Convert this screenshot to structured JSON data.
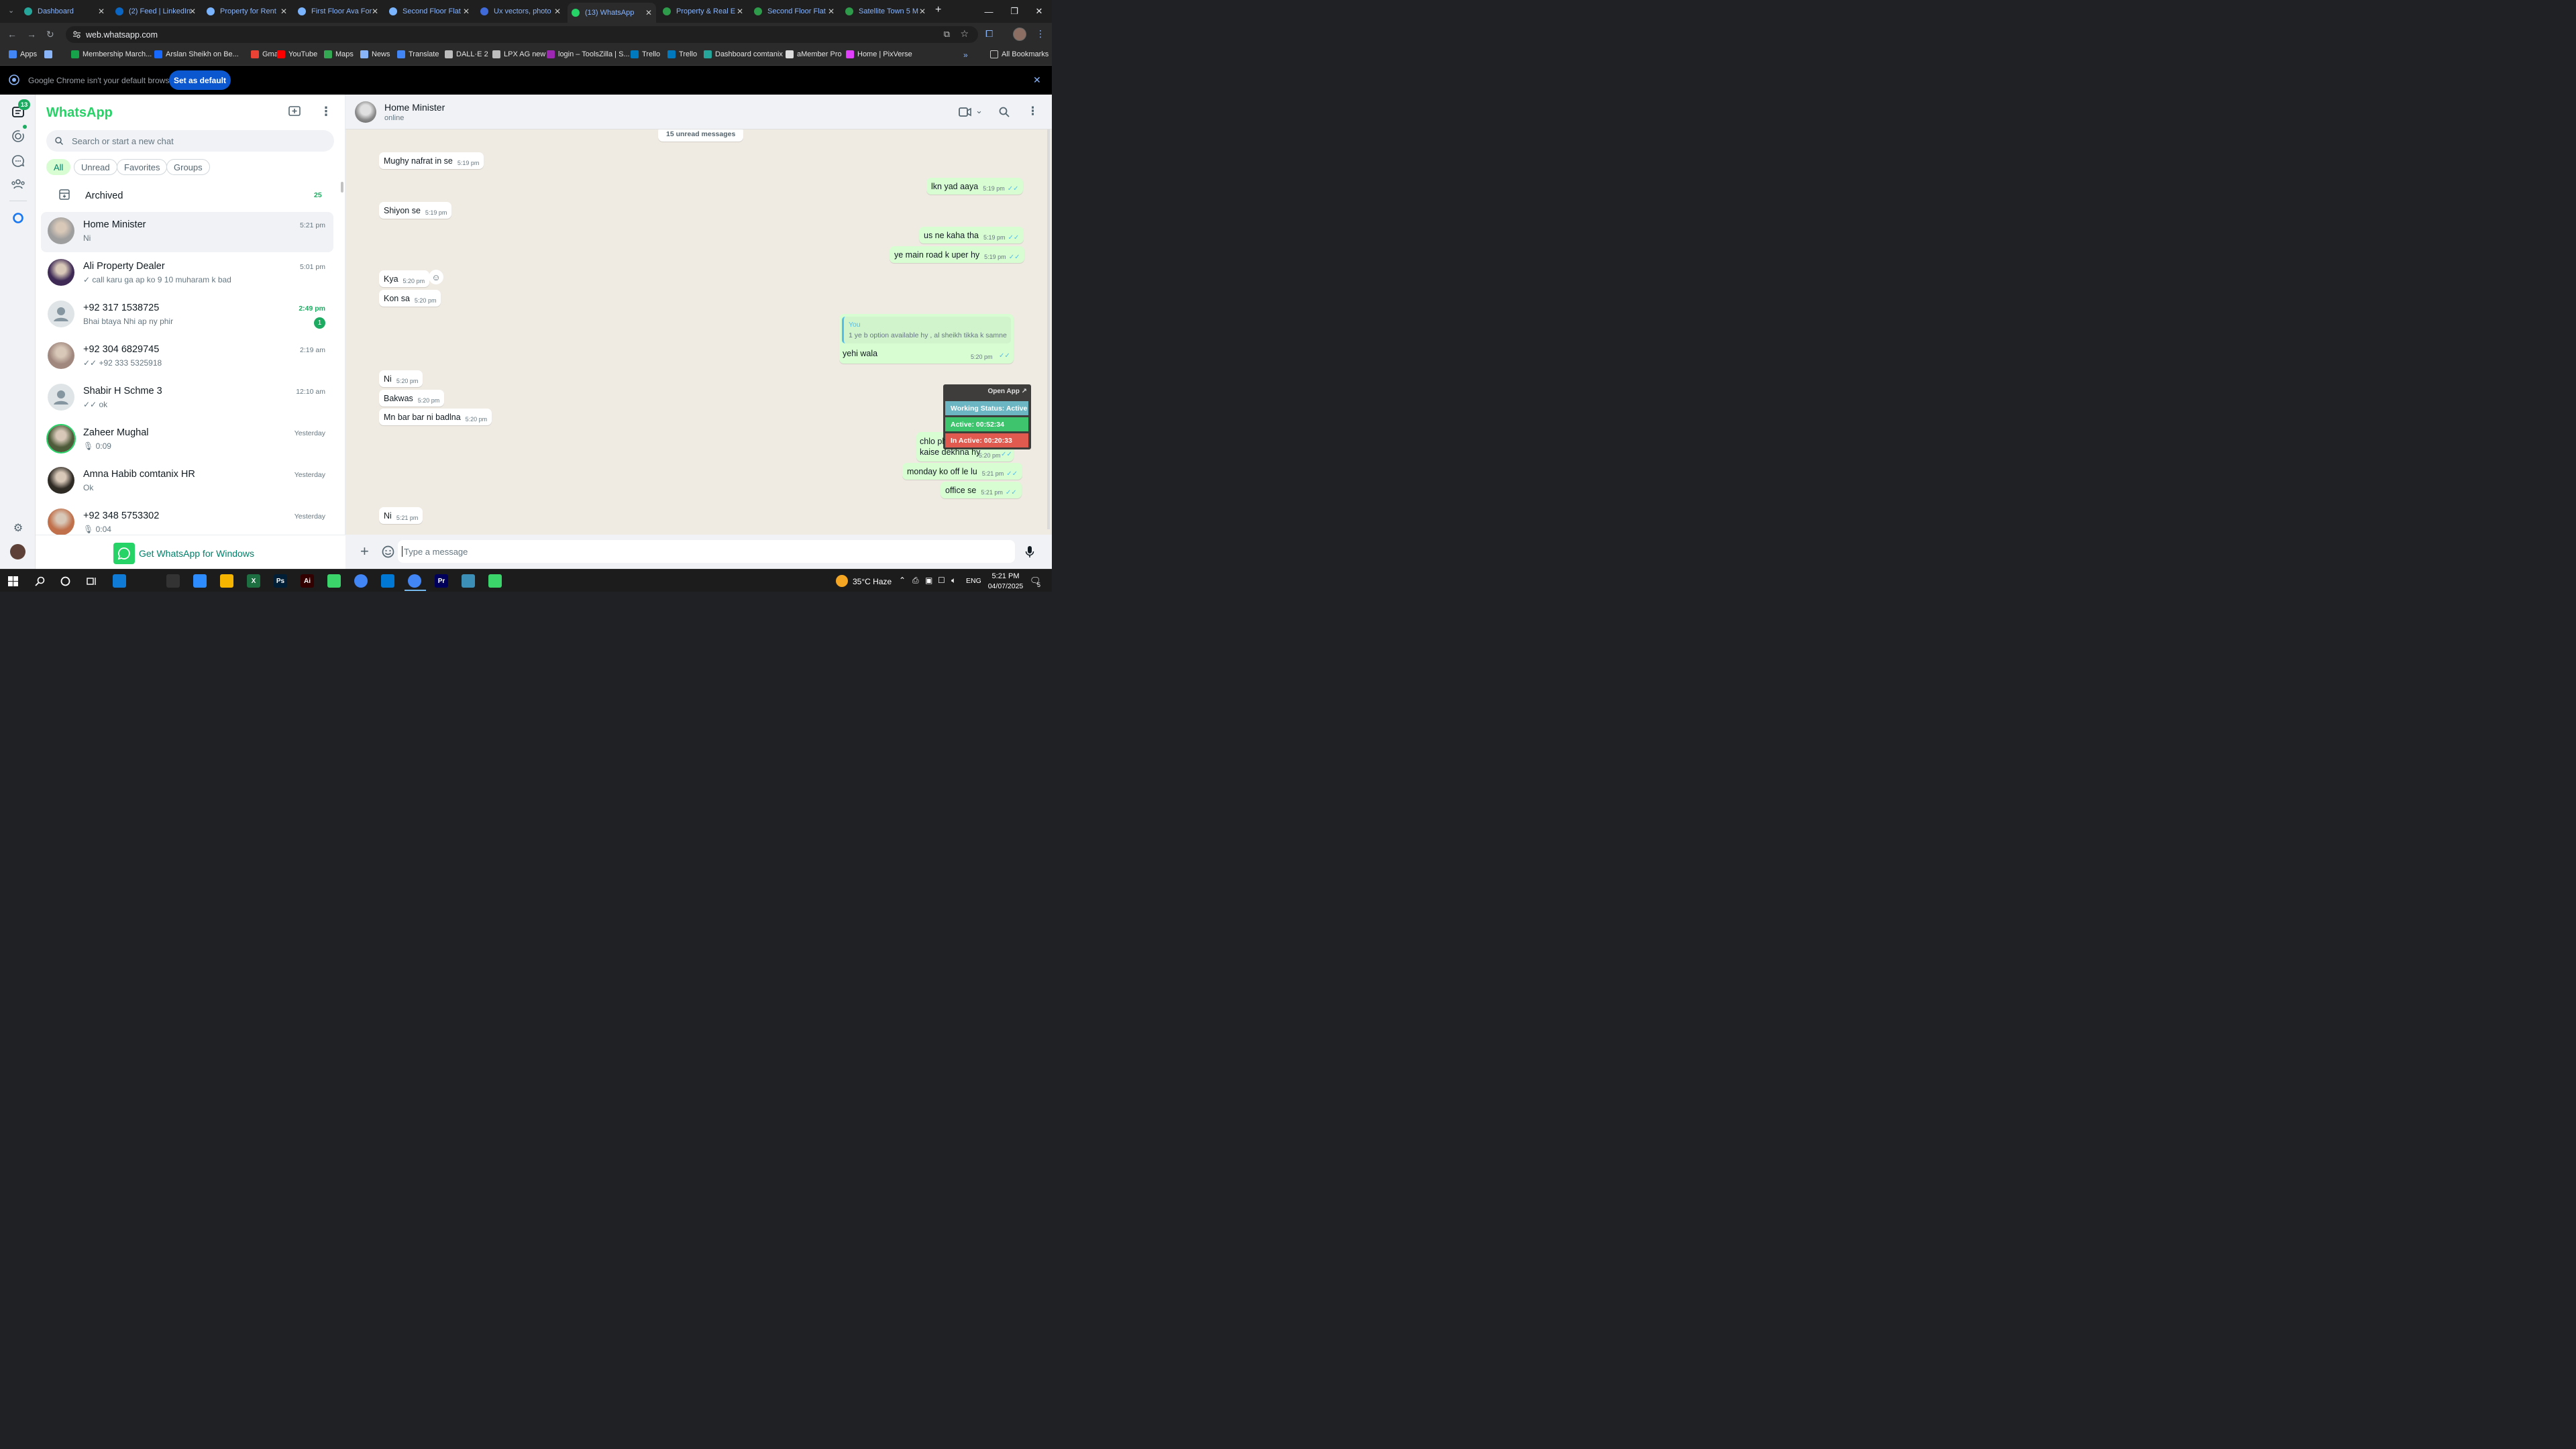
{
  "tabs": [
    {
      "label": "Dashboard",
      "color": "#26a69a"
    },
    {
      "label": "(2) Feed | LinkedIn",
      "color": "#0a66c2"
    },
    {
      "label": "Property for Rent",
      "color": "#7ab4ff"
    },
    {
      "label": "First Floor Ava For",
      "color": "#7ab4ff"
    },
    {
      "label": "Second Floor Flat",
      "color": "#7ab4ff"
    },
    {
      "label": "Ux vectors, photo",
      "color": "#3f6ad8"
    },
    {
      "label": "(13) WhatsApp",
      "color": "#25d366",
      "active": true
    },
    {
      "label": "Property & Real E",
      "color": "#2e9b4b"
    },
    {
      "label": "Second Floor Flat",
      "color": "#2e9b4b"
    },
    {
      "label": "Satellite Town 5 M",
      "color": "#2e9b4b"
    }
  ],
  "address_bar": {
    "url": "web.whatsapp.com"
  },
  "bookmarks": [
    {
      "label": "Apps",
      "color": "#4285f4"
    },
    {
      "label": "",
      "color": "#8ab4f8"
    },
    {
      "label": "Membership March...",
      "color": "#16a34a"
    },
    {
      "label": "Arslan Sheikh on Be...",
      "color": "#1769ff"
    },
    {
      "label": "Gmail",
      "color": "#ea4335"
    },
    {
      "label": "YouTube",
      "color": "#ff0000"
    },
    {
      "label": "Maps",
      "color": "#34a853"
    },
    {
      "label": "News",
      "color": "#8ab4f8"
    },
    {
      "label": "Translate",
      "color": "#4285f4"
    },
    {
      "label": "DALL·E 2",
      "color": "#bdbdbd"
    },
    {
      "label": "LPX AG new",
      "color": "#bdbdbd"
    },
    {
      "label": "login – ToolsZilla | S...",
      "color": "#9c27b0"
    },
    {
      "label": "Trello",
      "color": "#0079bf"
    },
    {
      "label": "Trello",
      "color": "#0079bf"
    },
    {
      "label": "Dashboard comtanix",
      "color": "#26a69a"
    },
    {
      "label": "aMember Pro",
      "color": "#dddddd"
    },
    {
      "label": "Home | PixVerse",
      "color": "#e040fb"
    }
  ],
  "all_bookmarks": "All Bookmarks",
  "infobar": {
    "text": "Google Chrome isn't your default browser",
    "button": "Set as default"
  },
  "rail": {
    "chats_badge": "13"
  },
  "sidebar": {
    "title": "WhatsApp",
    "search_placeholder": "Search or start a new chat",
    "filters": [
      "All",
      "Unread",
      "Favorites",
      "Groups"
    ],
    "archived_label": "Archived",
    "archived_count": "25",
    "get_windows": "Get WhatsApp for Windows"
  },
  "chats": [
    {
      "name": "Home Minister",
      "msg": "Ni",
      "time": "5:21 pm",
      "selected": true,
      "avatar": "#9e9e9e"
    },
    {
      "name": "Ali Property Dealer",
      "msg": "✓ call karu ga ap ko 9 10 muharam k bad",
      "time": "5:01 pm",
      "avatar": "#3e2a55"
    },
    {
      "name": "+92 317 1538725",
      "msg": "Bhai btaya Nhi ap ny phir",
      "time": "2:49 pm",
      "unread": "1",
      "avatar": "default"
    },
    {
      "name": "+92 304 6829745",
      "msg": "✓✓ +92 333 5325918",
      "time": "2:19 am",
      "avatar": "#a1887f"
    },
    {
      "name": "Shabir H  Schme 3",
      "msg": "✓✓ ok",
      "time": "12:10 am",
      "avatar": "default"
    },
    {
      "name": "Zaheer Mughal",
      "msg": "🎙 0:09",
      "time": "Yesterday",
      "avatar": "#4e5b3a"
    },
    {
      "name": "Amna Habib comtanix HR",
      "msg": "Ok",
      "time": "Yesterday",
      "avatar": "#2e2a24"
    },
    {
      "name": "+92 348 5753302",
      "msg": "🎙 0:04",
      "time": "Yesterday",
      "avatar": "#c0704a"
    }
  ],
  "chat": {
    "contact_name": "Home Minister",
    "status": "online",
    "unread_banner": "15 unread messages",
    "messages": [
      {
        "dir": "in",
        "text": "Mughy nafrat in se",
        "time": "5:19 pm"
      },
      {
        "dir": "out",
        "text": "lkn yad aaya",
        "time": "5:19 pm"
      },
      {
        "dir": "in",
        "text": "Shiyon se",
        "time": "5:19 pm"
      },
      {
        "dir": "out",
        "text": "us ne kaha tha",
        "time": "5:19 pm"
      },
      {
        "dir": "out",
        "text": "ye main road k uper hy",
        "time": "5:19 pm"
      },
      {
        "dir": "in",
        "text": "Kya",
        "time": "5:20 pm"
      },
      {
        "dir": "in",
        "text": "Kon sa",
        "time": "5:20 pm"
      },
      {
        "dir": "in",
        "text": "Ni",
        "time": "5:20 pm"
      },
      {
        "dir": "in",
        "text": "Bakwas",
        "time": "5:20 pm"
      },
      {
        "dir": "in",
        "text": "Mn bar bar ni badlna",
        "time": "5:20 pm"
      },
      {
        "dir": "out",
        "text": "monday ko off le lu",
        "time": "5:21 pm"
      },
      {
        "dir": "out",
        "text": "office se",
        "time": "5:21 pm"
      },
      {
        "dir": "in",
        "text": "Ni",
        "time": "5:21 pm"
      }
    ],
    "quoted_reply": {
      "author": "You",
      "quote": "1 ye b option available hy , al sheikh tikka k samne",
      "text": "yehi wala",
      "time": "5:20 pm"
    },
    "partial_message": {
      "line1": "chlo ph",
      "line2": "kaise dekhna hy",
      "time": "5:20 pm"
    },
    "composer_placeholder": "Type a message"
  },
  "tracker": {
    "open_app": "Open App ↗",
    "working": "Working Status: Active",
    "active": "Active: 00:52:34",
    "inactive": "In Active: 00:20:33"
  },
  "taskbar": {
    "weather": "35°C Haze",
    "lang": "ENG",
    "time": "5:21 PM",
    "date": "04/07/2025",
    "notif_count": "5",
    "apps": [
      {
        "label": "",
        "color": "#3aa0ff"
      },
      {
        "label": "",
        "color": "#2d8cff"
      },
      {
        "label": "",
        "color": "#f4b400"
      },
      {
        "label": "X",
        "color": "#1d6f42"
      },
      {
        "label": "Ps",
        "color": "#001e36"
      },
      {
        "label": "Ai",
        "color": "#330000"
      },
      {
        "label": "",
        "color": "#3ad46a"
      },
      {
        "label": "",
        "color": "#4285f4"
      },
      {
        "label": "",
        "color": "#0078d4"
      },
      {
        "label": "",
        "color": "#4285f4"
      },
      {
        "label": "Pr",
        "color": "#00005b"
      },
      {
        "label": "",
        "color": "#3c8fb7"
      },
      {
        "label": "",
        "color": "#3ad46a"
      }
    ]
  }
}
